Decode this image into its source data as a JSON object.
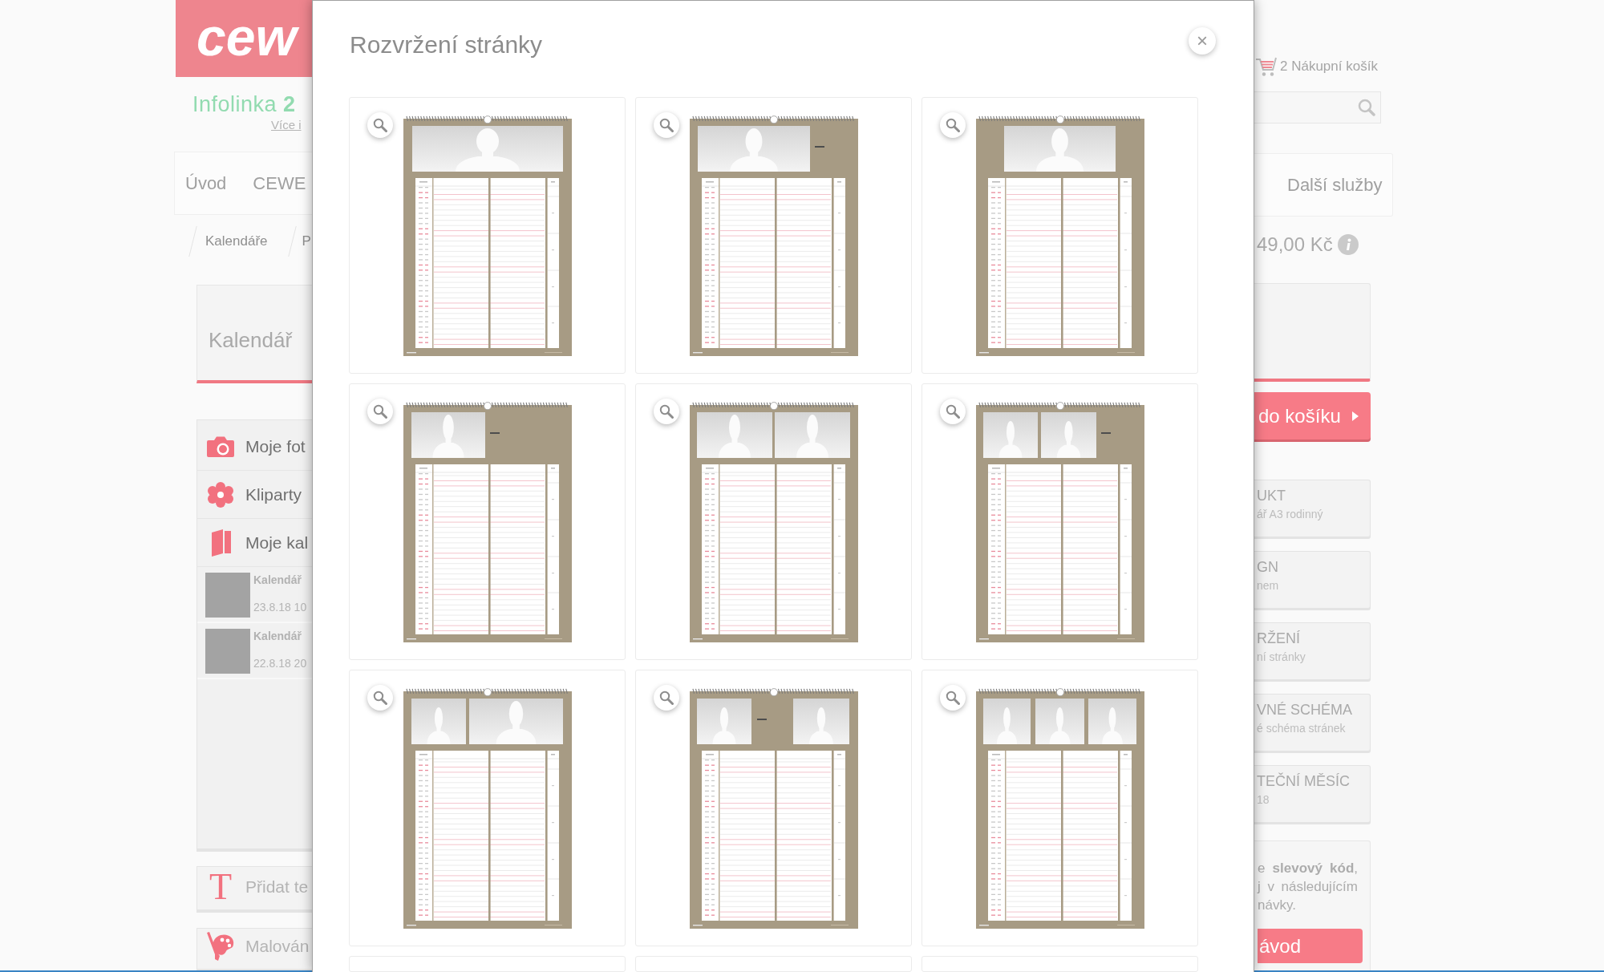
{
  "background_page": {
    "logo": {
      "text": "cew"
    },
    "hotline": {
      "text": "Infolinka **2**",
      "link": "Více i"
    },
    "nav": {
      "left_items": [
        "Úvod",
        "CEWE"
      ],
      "right_items": [
        "Další služby"
      ]
    },
    "breadcrumb": [
      "Kalendáře",
      "P"
    ],
    "product_title": "Kalendář",
    "sidebar": {
      "items": [
        {
          "kind": "photos",
          "label": "Moje fot"
        },
        {
          "kind": "cliparts",
          "label": "Kliparty"
        },
        {
          "kind": "calendars",
          "label": "Moje kal"
        }
      ],
      "projects": [
        {
          "name": "Kalendář",
          "date": "23.8.18 10"
        },
        {
          "name": "Kalendář",
          "date": "22.8.18 20"
        }
      ]
    },
    "tools": [
      {
        "kind": "text",
        "icon": "T",
        "label": "Přidat te"
      },
      {
        "kind": "painting",
        "label": "Malován"
      }
    ],
    "cart": {
      "label": "2 Nákupní košík"
    },
    "price": "49,00 Kč",
    "add_to_cart": "do košíku",
    "option_cards": [
      {
        "title": "UKT",
        "subtitle": "ář A3 rodinný"
      },
      {
        "title": "GN",
        "subtitle": "nem"
      },
      {
        "title": "RŽENÍ",
        "subtitle": "ní stránky"
      },
      {
        "title": "VNÉ SCHÉMA",
        "subtitle": "é schéma stránek"
      },
      {
        "title": "TEČNÍ MĚSÍC",
        "subtitle": "18"
      }
    ],
    "discount": {
      "text_lines": [
        "e **slevový kód**,",
        "j v následujícím",
        "návky."
      ],
      "button": "ávod"
    }
  },
  "dialog": {
    "title": "Rozvržení stránky",
    "close": "×",
    "layouts": [
      {
        "kind": "wide-photo",
        "selected": false
      },
      {
        "kind": "photo-and-title",
        "selected": false
      },
      {
        "kind": "centered-photo",
        "selected": false
      },
      {
        "kind": "small-photo-and-title",
        "selected": false
      },
      {
        "kind": "two-photos",
        "selected": false
      },
      {
        "kind": "two-photos-and-title",
        "selected": false
      },
      {
        "kind": "small-and-large-photo",
        "selected": false
      },
      {
        "kind": "photo-title-photo",
        "selected": false
      },
      {
        "kind": "three-photos",
        "selected": false
      },
      {
        "selected": false
      },
      {
        "selected": false
      },
      {
        "selected": false
      }
    ]
  }
}
